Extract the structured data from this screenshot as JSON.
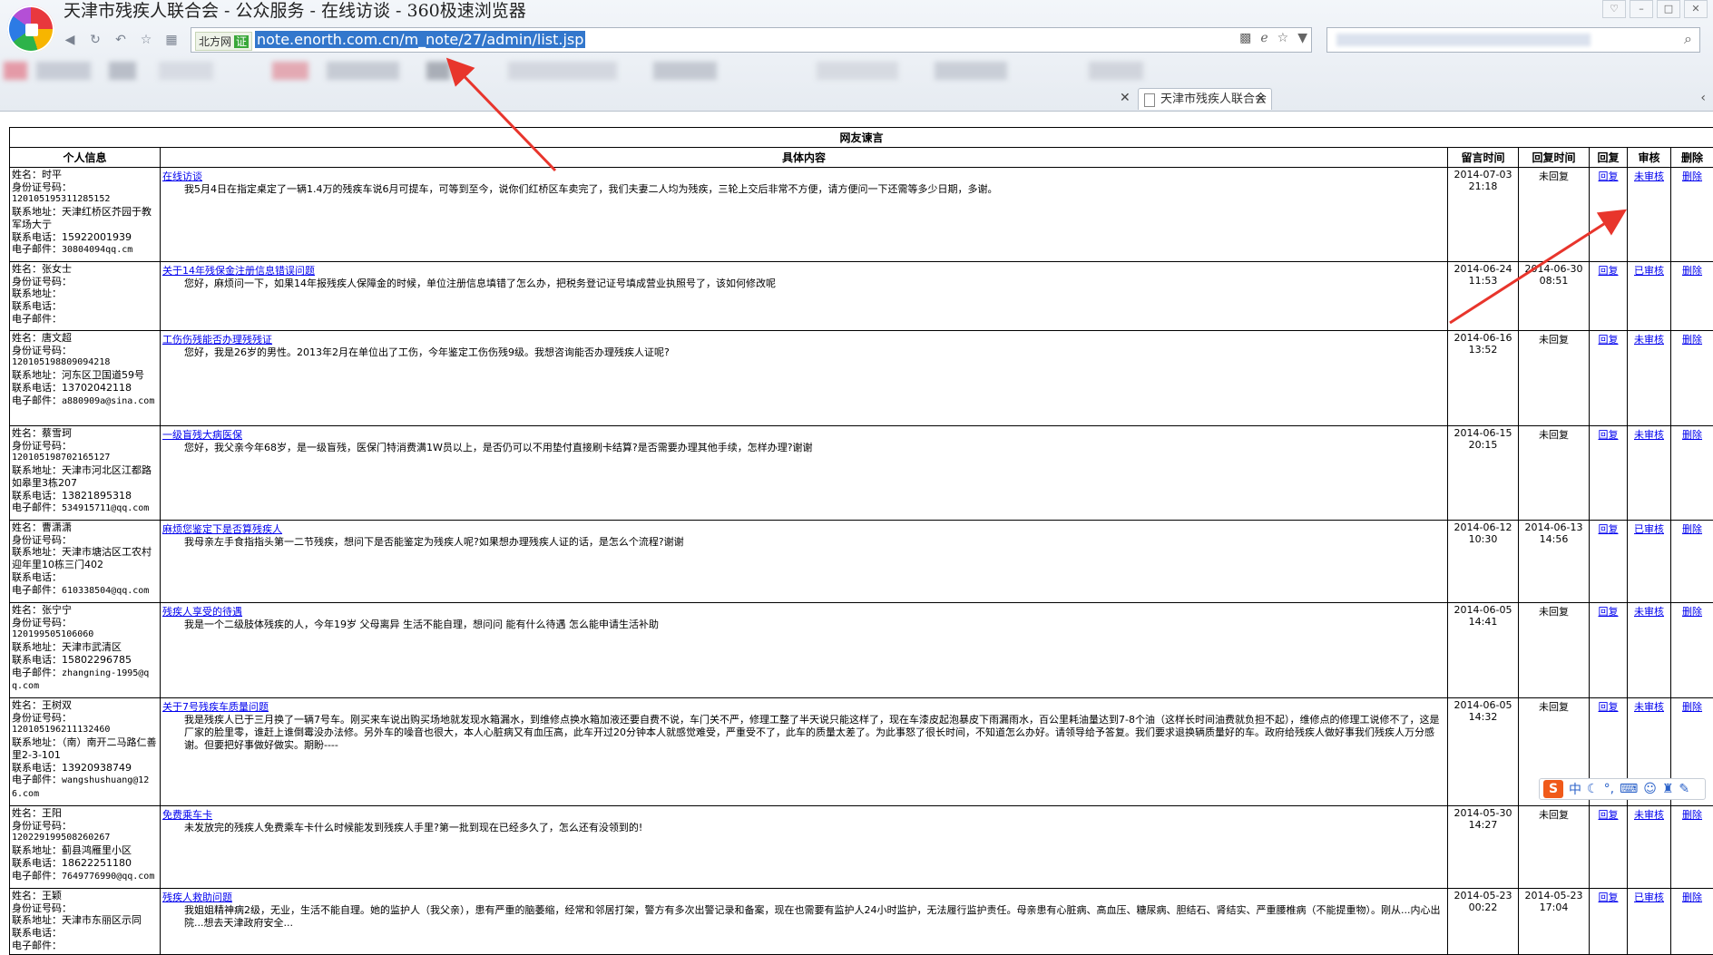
{
  "window": {
    "title": "天津市残疾人联合会 - 公众服务 - 在线访谈 - 360极速浏览器"
  },
  "toolbar": {
    "site_badge": "北方网",
    "site_badge_tag": "证",
    "url": "note.enorth.com.cn/m_note/27/admin/list.jsp"
  },
  "tab": {
    "label": "天津市残疾人联合会"
  },
  "table": {
    "caption": "网友谏言",
    "headers": {
      "info": "个人信息",
      "content": "具体内容",
      "msg_time": "留言时间",
      "reply_time": "回复时间",
      "reply": "回复",
      "review": "审核",
      "delete": "删除"
    },
    "labels": {
      "name": "姓名：",
      "id": "身份证号码：",
      "addr": "联系地址：",
      "phone": "联系电话：",
      "email": "电子邮件："
    },
    "rows": [
      {
        "name": "时平",
        "id": "120105195311285152",
        "addr": "天津红桥区芥园于教军场大亍",
        "phone": "15922001939",
        "email": "30804094qq.cm",
        "subject": "在线访谈",
        "body": "我5月4日在指定桌定了一辆1.4万的残疾车说6月可提车，可等到至今，说你们红桥区车卖完了，我们夫妻二人均为残疾，三轮上交后非常不方便，请方便问一下还需等多少日期，多谢。",
        "msg_date": "2014-07-03",
        "msg_time": "21:18",
        "reply_date": "未回复",
        "reply_time": "",
        "reply": "回复",
        "review": "未审核",
        "delete": "删除"
      },
      {
        "name": "张女士",
        "id": "",
        "addr": "",
        "phone": "",
        "email": "",
        "subject": "关于14年残保金注册信息错误问题",
        "body": "您好，麻烦问一下，如果14年报残疾人保障金的时候，单位注册信息填错了怎么办，把税务登记证号填成营业执照号了，该如何修改呢",
        "msg_date": "2014-06-24",
        "msg_time": "11:53",
        "reply_date": "2014-06-30",
        "reply_time": "08:51",
        "reply": "回复",
        "review": "已审核",
        "delete": "删除"
      },
      {
        "name": "唐文超",
        "id": "120105198809094218",
        "addr": "河东区卫国道59号",
        "phone": "13702042118",
        "email": "a880909a@sina.com",
        "subject": "工伤伤残能否办理残残证",
        "body": "您好，我是26岁的男性。2013年2月在单位出了工伤，今年鉴定工伤伤残9级。我想咨询能否办理残疾人证呢?",
        "msg_date": "2014-06-16",
        "msg_time": "13:52",
        "reply_date": "未回复",
        "reply_time": "",
        "reply": "回复",
        "review": "未审核",
        "delete": "删除"
      },
      {
        "name": "蔡雪珂",
        "id": "120105198702165127",
        "addr": "天津市河北区江都路如皋里3栋207",
        "phone": "13821895318",
        "email": "534915711@qq.com",
        "subject": "一级盲残大病医保",
        "body": "您好，我父亲今年68岁，是一级盲残，医保门特消费满1W员以上，是否仍可以不用垫付直接刷卡结算?是否需要办理其他手续，怎样办理?谢谢",
        "msg_date": "2014-06-15",
        "msg_time": "20:15",
        "reply_date": "未回复",
        "reply_time": "",
        "reply": "回复",
        "review": "未审核",
        "delete": "删除"
      },
      {
        "name": "曹潇潇",
        "id": "",
        "addr": "天津市塘沽区工农村迎年里10栋三门402",
        "phone": "",
        "email": "610338504@qq.com",
        "subject": "麻烦您鉴定下是否算残疾人",
        "body": "我母亲左手食指指头第一二节残疾，想问下是否能鉴定为残疾人呢?如果想办理残疾人证的话，是怎么个流程?谢谢",
        "msg_date": "2014-06-12",
        "msg_time": "10:30",
        "reply_date": "2014-06-13",
        "reply_time": "14:56",
        "reply": "回复",
        "review": "已审核",
        "delete": "删除"
      },
      {
        "name": "张宁宁",
        "id": "120199505106060",
        "addr": "天津市武清区",
        "phone": "15802296785",
        "email": "zhangning-1995@qq.com",
        "subject": "残疾人享受的待遇",
        "body": "我是一个二级肢体残疾的人，今年19岁 父母离异 生活不能自理，想问问 能有什么待遇 怎么能申请生活补助",
        "msg_date": "2014-06-05",
        "msg_time": "14:41",
        "reply_date": "未回复",
        "reply_time": "",
        "reply": "回复",
        "review": "未审核",
        "delete": "删除"
      },
      {
        "name": "王树双",
        "id": "120105196211132460",
        "addr": "（南）南开二马路仁善里2-3-101",
        "phone": "13920938749",
        "email": "wangshushuang@126.com",
        "subject": "关于7号残疾车质量问题",
        "body": "我是残疾人已于三月换了一辆7号车。刚买来车说出购买场地就发现水箱漏水，到维修点换水箱加液还要自费不说，车门关不严，修理工整了半天说只能这样了，现在车漆皮起泡暴皮下雨漏雨水，百公里耗油量达到7-8个油（这样长时间油费就负担不起），维修点的修理工说修不了，这是厂家的脸里零，谁赶上谁倒霉没办法修。另外车的噪音也很大，本人心脏病又有血压高，此车开过20分钟本人就感觉难受，严重受不了，此车的质量太差了。为此事怒了很长时间，不知道怎么办好。请领导给予答复。我们要求退换辆质量好的车。政府给残疾人做好事我们残疾人万分感谢。但要把好事做好做实。期盼----",
        "msg_date": "2014-06-05",
        "msg_time": "14:32",
        "reply_date": "未回复",
        "reply_time": "",
        "reply": "回复",
        "review": "未审核",
        "delete": "删除"
      },
      {
        "name": "王阳",
        "id": "120229199508260267",
        "addr": "蓟县鸿雁里小区",
        "phone": "18622251180",
        "email": "7649776990@qq.com",
        "subject": "免费乘车卡",
        "body": "未发放完的残疾人免费乘车卡什么时候能发到残疾人手里?第一批到现在已经多久了，怎么还有没领到的!",
        "msg_date": "2014-05-30",
        "msg_time": "14:27",
        "reply_date": "未回复",
        "reply_time": "",
        "reply": "回复",
        "review": "未审核",
        "delete": "删除"
      },
      {
        "name": "王颖",
        "id": "",
        "addr": "天津市东丽区示同",
        "phone": "",
        "email": "",
        "subject": "残疾人救助问题",
        "body": "我姐姐精神病2级，无业，生活不能自理。她的监护人（我父亲），患有严重的脑萎缩，经常和邻居打架，警方有多次出警记录和备案，现在也需要有监护人24小时监护，无法履行监护责任。母亲患有心脏病、高血压、糖尿病、胆结石、肾结实、严重腰椎病（不能提重物）。刚从...内心出院...想去天津政府安全...",
        "msg_date": "2014-05-23",
        "msg_time": "00:22",
        "reply_date": "2014-05-23",
        "reply_time": "17:04",
        "reply": "回复",
        "review": "已审核",
        "delete": "删除"
      }
    ]
  },
  "ime": {
    "logo": "S",
    "mode": "中"
  },
  "colors": {
    "link": "#0000ee",
    "arrow": "#e8352c",
    "url_highlight": "#3377cc"
  }
}
